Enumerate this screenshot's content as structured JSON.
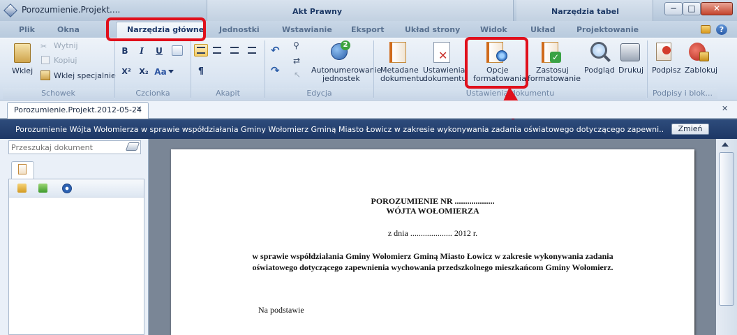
{
  "window": {
    "title": "Porozumienie.Projekt....",
    "context_group_1": "Akt Prawny",
    "context_group_2": "Narzędzia tabel",
    "min": "−",
    "max": "□",
    "close": "✕"
  },
  "tabs": [
    "Plik",
    "Okna",
    "Narzędzia główne",
    "Jednostki",
    "Wstawianie",
    "Eksport",
    "Układ strony",
    "Widok",
    "Układ",
    "Projektowanie"
  ],
  "ribbon": {
    "schowek": {
      "label": "Schowek",
      "wklej": "Wklej",
      "wytnij": "Wytnij",
      "kopiuj": "Kopiuj",
      "wklej_specjalnie": "Wklej specjalnie"
    },
    "czcionka": {
      "label": "Czcionka",
      "bold": "B",
      "italic": "I",
      "underline": "U",
      "sup": "X²",
      "sub": "X₂",
      "aa": "Aa"
    },
    "akapit": {
      "label": "Akapit",
      "pilcrow": "¶"
    },
    "edycja": {
      "label": "Edycja",
      "auto_line1": "Autonumerowanie",
      "auto_line2": "jednostek"
    },
    "ustawienia": {
      "label": "Ustawienia dokumentu",
      "metadane_l1": "Metadane",
      "metadane_l2": "dokumentu",
      "ustawienia_l1": "Ustawienia",
      "ustawienia_l2": "dokumentu",
      "opcje_l1": "Opcje",
      "opcje_l2": "formatowania",
      "zastosuj_l1": "Zastosuj",
      "zastosuj_l2": "formatowanie",
      "podglad": "Podgląd",
      "drukuj": "Drukuj"
    },
    "podpisy": {
      "label": "Podpisy i blok...",
      "podpisz": "Podpisz",
      "zablokuj": "Zablokuj"
    }
  },
  "doc_tab": {
    "label": "Porozumienie.Projekt.2012-05-24",
    "close": "✕"
  },
  "strip_close": "✕",
  "infobar": {
    "text": "Porozumienie Wójta Wołomierza w sprawie współdziałania Gminy Wołomierz Gminą Miasto Łowicz w zakresie wykonywania zadania oświatowego dotyczącego zapewni...",
    "button": "Zmień"
  },
  "left": {
    "search_placeholder": "Przeszukaj dokument"
  },
  "document": {
    "line1": "POROZUMIENIE NR ...................",
    "line2": "WÓJTA WOŁOMIERZA",
    "date": "z dnia .................... 2012 r.",
    "subject1": "w sprawie współdziałania Gminy Wołomierz Gminą Miasto Łowicz w zakresie wykonywania zadania",
    "subject2": "oświatowego dotyczącego zapewnienia wychowania przedszkolnego mieszkańcom Gminy Wołomierz.",
    "body": "Na podstawie"
  },
  "colors": {
    "highlight": "#e0101c",
    "infobar": "#1d3765"
  }
}
